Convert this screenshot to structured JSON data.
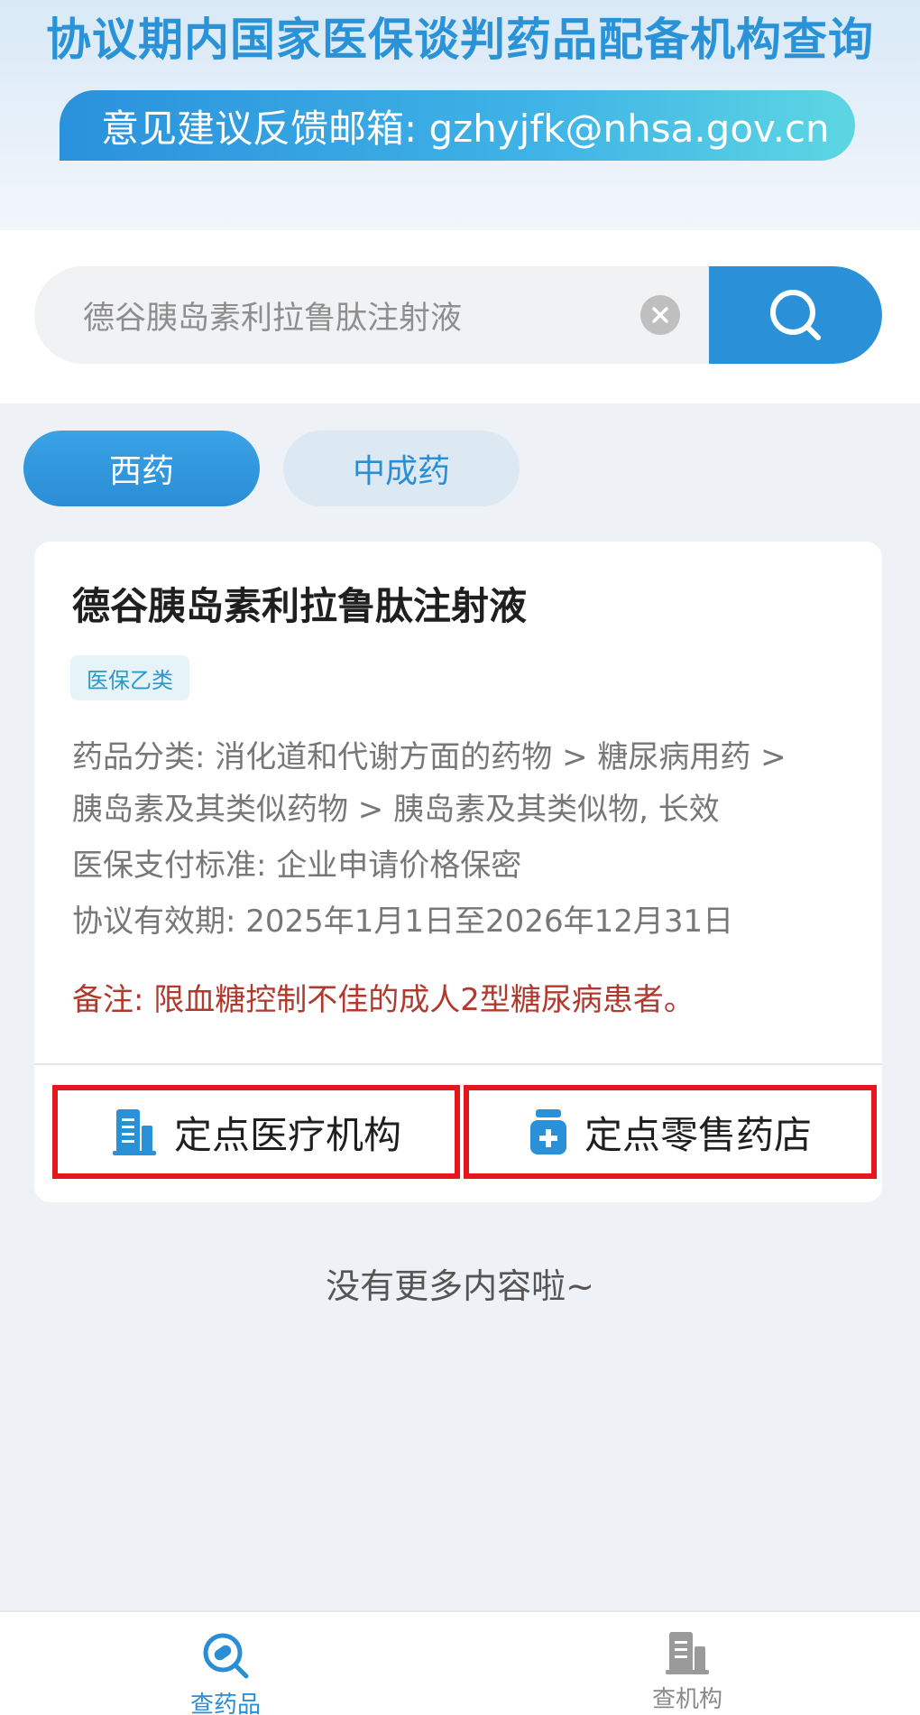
{
  "header": {
    "title": "协议期内国家医保谈判药品配备机构查询",
    "feedback": "意见建议反馈邮箱: gzhyjfk@nhsa.gov.cn"
  },
  "search": {
    "value": "德谷胰岛素利拉鲁肽注射液",
    "clear_icon": "close-circle-icon",
    "search_icon": "search-icon"
  },
  "tabs": [
    {
      "label": "西药",
      "active": true
    },
    {
      "label": "中成药",
      "active": false
    }
  ],
  "drug": {
    "name": "德谷胰岛素利拉鲁肽注射液",
    "tag": "医保乙类",
    "category_line1": "药品分类: 消化道和代谢方面的药物 > 糖尿病用药 >",
    "category_line2": "胰岛素及其类似药物 > 胰岛素及其类似物, 长效",
    "payment": "医保支付标准: 企业申请价格保密",
    "validity": "协议有效期: 2025年1月1日至2026年12月31日",
    "remark": "备注: 限血糖控制不佳的成人2型糖尿病患者。"
  },
  "actions": {
    "medical": "定点医疗机构",
    "pharmacy": "定点零售药店"
  },
  "no_more": "没有更多内容啦~",
  "nav": {
    "drug": "查药品",
    "institution": "查机构"
  },
  "colors": {
    "primary": "#2a91d8",
    "highlight_border": "#e5161d",
    "remark": "#b03a2e"
  }
}
